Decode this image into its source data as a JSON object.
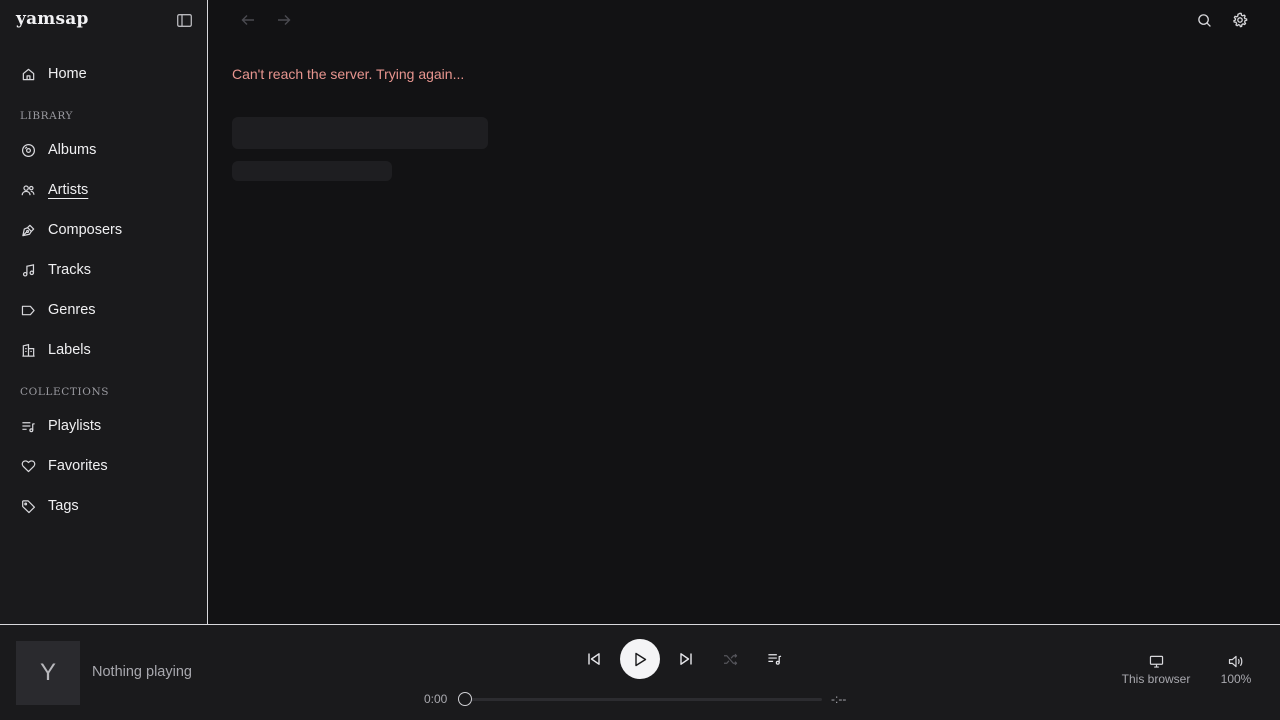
{
  "app": {
    "name": "yamsap"
  },
  "sidebar": {
    "home": {
      "label": "Home",
      "icon": "home-icon"
    },
    "library_heading": "LIBRARY",
    "library_items": [
      {
        "label": "Albums",
        "icon": "disc-icon"
      },
      {
        "label": "Artists",
        "icon": "users-icon",
        "active": true
      },
      {
        "label": "Composers",
        "icon": "pen-icon"
      },
      {
        "label": "Tracks",
        "icon": "music-note-icon"
      },
      {
        "label": "Genres",
        "icon": "tag-label-icon"
      },
      {
        "label": "Labels",
        "icon": "building-icon"
      }
    ],
    "collections_heading": "COLLECTIONS",
    "collection_items": [
      {
        "label": "Playlists",
        "icon": "playlist-icon"
      },
      {
        "label": "Favorites",
        "icon": "heart-icon"
      },
      {
        "label": "Tags",
        "icon": "tag-icon"
      }
    ]
  },
  "main": {
    "error_message": "Can't reach the server. Trying again..."
  },
  "player": {
    "artwork_letter": "Y",
    "now_playing": "Nothing playing",
    "elapsed": "0:00",
    "remaining": "-:--",
    "progress": 0,
    "device_label": "This browser",
    "volume_label": "100%"
  },
  "colors": {
    "background": "#121214",
    "sidebar": "#1a1a1c",
    "error": "#e8958f",
    "play_button": "#f4f4f6"
  }
}
